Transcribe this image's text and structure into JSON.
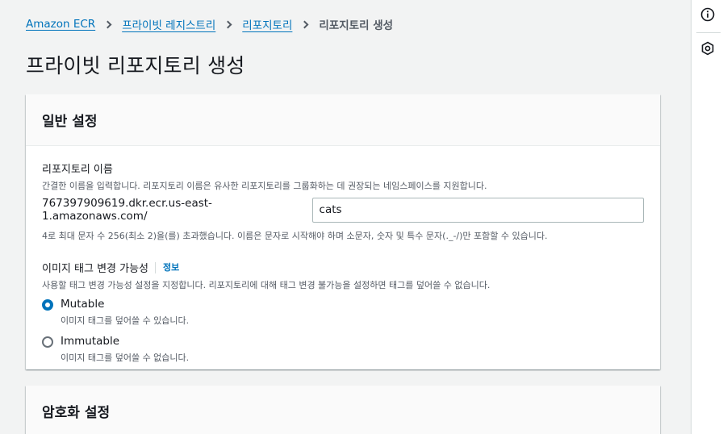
{
  "breadcrumb": {
    "items": [
      "Amazon ECR",
      "프라이빗 레지스트리",
      "리포지토리"
    ],
    "current": "리포지토리 생성"
  },
  "page": {
    "title": "프라이빗 리포지토리 생성"
  },
  "general": {
    "header": "일반 설정",
    "repo_name_label": "리포지토리 이름",
    "repo_name_desc": "간결한 이름을 입력합니다. 리포지토리 이름은 유사한 리포지토리를 그룹화하는 데 권장되는 네임스페이스를 지원합니다.",
    "repo_prefix": "767397909619.dkr.ecr.us-east-1.amazonaws.com/",
    "repo_value": "cats",
    "constraint": "4로 최대 문자 수 256(최소 2)을(를) 초과했습니다. 이름은 문자로 시작해야 하며 소문자, 숫자 및 특수 문자(._-/)만 포함할 수 있습니다.",
    "tag_label": "이미지 태그 변경 가능성",
    "info": "정보",
    "tag_desc": "사용할 태그 변경 가능성 설정을 지정합니다. 리포지토리에 대해 태그 변경 불가능을 설정하면 태그를 덮어쓸 수 없습니다.",
    "options": [
      {
        "label": "Mutable",
        "desc": "이미지 태그를 덮어쓸 수 있습니다.",
        "selected": true
      },
      {
        "label": "Immutable",
        "desc": "이미지 태그를 덮어쓸 수 없습니다.",
        "selected": false
      }
    ]
  },
  "encryption": {
    "header": "암호화 설정"
  },
  "rail": {
    "icons": [
      "info-icon",
      "settings-hex-icon"
    ]
  },
  "colors": {
    "link": "#0073bb",
    "background": "#f2f3f3",
    "text": "#16191f",
    "muted": "#545b64"
  }
}
